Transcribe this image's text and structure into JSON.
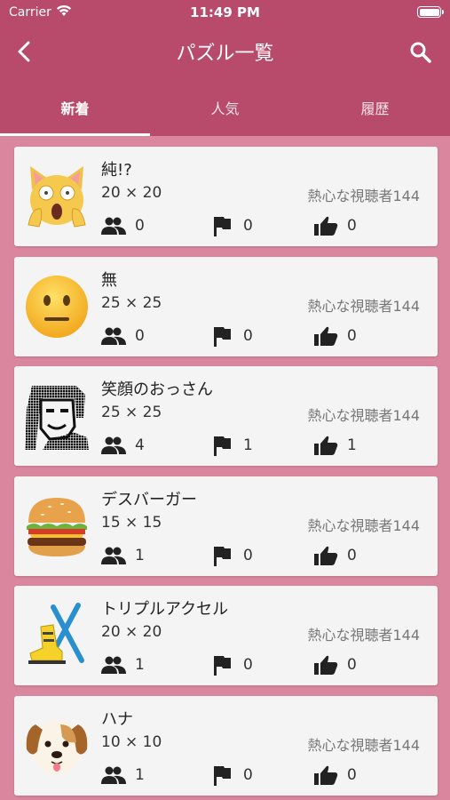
{
  "status_bar": {
    "carrier": "Carrier",
    "time": "11:49 PM"
  },
  "nav": {
    "title": "パズル一覧"
  },
  "tabs": [
    {
      "label": "新着",
      "active": true
    },
    {
      "label": "人気",
      "active": false
    },
    {
      "label": "履歴",
      "active": false
    }
  ],
  "puzzles": [
    {
      "name": "純!?",
      "size": "20 × 20",
      "author": "熱心な視聴者144",
      "players": "0",
      "clears": "0",
      "likes": "0",
      "thumb": "scared-cat-icon"
    },
    {
      "name": "無",
      "size": "25 × 25",
      "author": "熱心な視聴者144",
      "players": "0",
      "clears": "0",
      "likes": "0",
      "thumb": "neutral-face-icon"
    },
    {
      "name": "笑顔のおっさん",
      "size": "25 × 25",
      "author": "熱心な視聴者144",
      "players": "4",
      "clears": "1",
      "likes": "1",
      "thumb": "pixel-portrait-icon"
    },
    {
      "name": "デスバーガー",
      "size": "15 × 15",
      "author": "熱心な視聴者144",
      "players": "1",
      "clears": "0",
      "likes": "0",
      "thumb": "hamburger-icon"
    },
    {
      "name": "トリプルアクセル",
      "size": "20 × 20",
      "author": "熱心な視聴者144",
      "players": "1",
      "clears": "0",
      "likes": "0",
      "thumb": "ski-icon"
    },
    {
      "name": "ハナ",
      "size": "10 × 10",
      "author": "熱心な視聴者144",
      "players": "1",
      "clears": "0",
      "likes": "0",
      "thumb": "dog-face-icon"
    }
  ],
  "colors": {
    "primary": "#b84a6b",
    "background": "#d9869e",
    "card": "#f4f4f4"
  }
}
